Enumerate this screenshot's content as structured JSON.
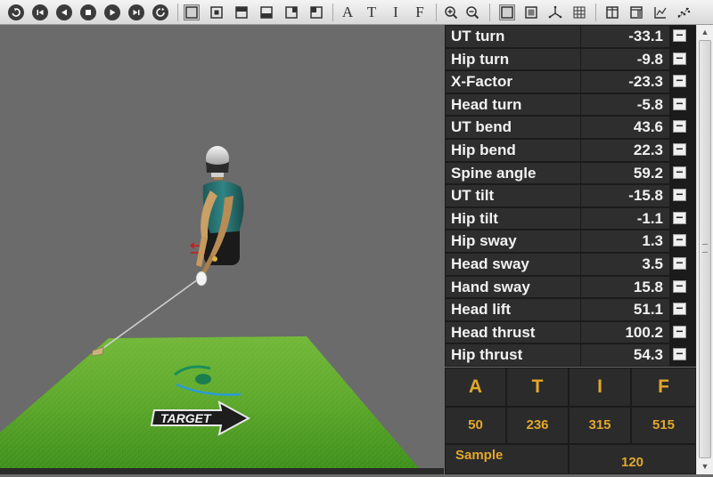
{
  "toolbar": {
    "playback_icons": [
      "refresh-icon",
      "step-back-icon",
      "play-reverse-icon",
      "stop-icon",
      "play-icon",
      "step-forward-icon",
      "reset-icon"
    ],
    "view_icons": [
      "frame-full-icon",
      "frame-center-icon",
      "frame-top-icon",
      "frame-bottom-icon",
      "frame-right-icon",
      "frame-left-icon"
    ],
    "phase_letters": [
      "A",
      "T",
      "I",
      "F"
    ],
    "tool_icons": [
      "zoom-in-icon",
      "zoom-out-icon",
      "view-box-icon",
      "view-inset-icon",
      "axes-icon",
      "grid-icon",
      "layout-split-icon",
      "layout-panel-icon",
      "chart-icon",
      "scatter-icon"
    ]
  },
  "scene": {
    "target_label": "TARGET"
  },
  "metrics": [
    {
      "name": "UT turn",
      "value": "-33.1"
    },
    {
      "name": "Hip turn",
      "value": "-9.8"
    },
    {
      "name": "X-Factor",
      "value": "-23.3"
    },
    {
      "name": "Head turn",
      "value": "-5.8"
    },
    {
      "name": "UT bend",
      "value": "43.6"
    },
    {
      "name": "Hip bend",
      "value": "22.3"
    },
    {
      "name": "Spine angle",
      "value": "59.2"
    },
    {
      "name": "UT tilt",
      "value": "-15.8"
    },
    {
      "name": "Hip tilt",
      "value": "-1.1"
    },
    {
      "name": "Hip sway",
      "value": "1.3"
    },
    {
      "name": "Head sway",
      "value": "3.5"
    },
    {
      "name": "Hand sway",
      "value": "15.8"
    },
    {
      "name": "Head lift",
      "value": "51.1"
    },
    {
      "name": "Head thrust",
      "value": "100.2"
    },
    {
      "name": "Hip thrust",
      "value": "54.3"
    }
  ],
  "metric_collapse_symbol": "−",
  "phases": {
    "letters": [
      "A",
      "T",
      "I",
      "F"
    ],
    "values": [
      "50",
      "236",
      "315",
      "515"
    ],
    "sample_label": "Sample",
    "sample_value": "120"
  },
  "colors": {
    "accent": "#e2a72d",
    "panel_bg": "#1b1b1b",
    "cell_bg": "#2e2e2e",
    "grass": "#5da82c"
  }
}
